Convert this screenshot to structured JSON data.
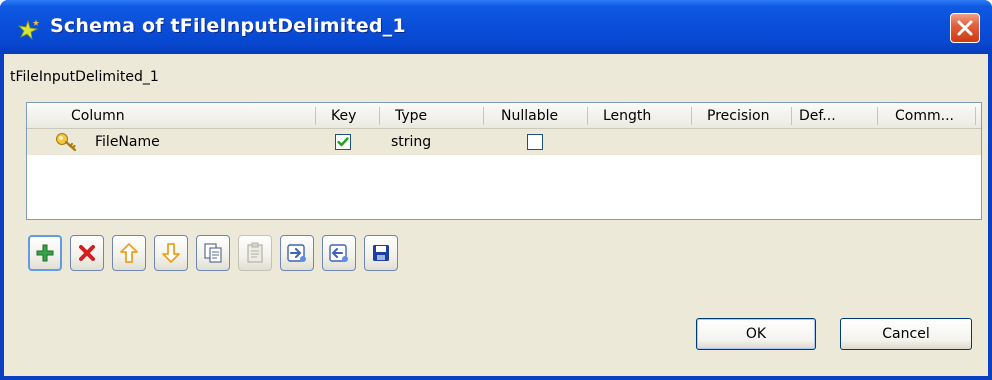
{
  "window": {
    "title": "Schema of tFileInputDelimited_1",
    "close_icon": "close-icon"
  },
  "component_label": "tFileInputDelimited_1",
  "table": {
    "columns": [
      "Column",
      "Key",
      "Type",
      "Nullable",
      "Length",
      "Precision",
      "Def...",
      "Comm..."
    ],
    "rows": [
      {
        "column": "FileName",
        "key": true,
        "type": "string",
        "nullable": false,
        "length": "",
        "precision": "",
        "default": "",
        "comment": ""
      }
    ]
  },
  "toolbar": {
    "buttons": [
      {
        "name": "add-icon",
        "enabled": true
      },
      {
        "name": "delete-icon",
        "enabled": true
      },
      {
        "name": "move-up-icon",
        "enabled": true
      },
      {
        "name": "move-down-icon",
        "enabled": true
      },
      {
        "name": "copy-icon",
        "enabled": true
      },
      {
        "name": "paste-icon",
        "enabled": false
      },
      {
        "name": "import-icon",
        "enabled": true
      },
      {
        "name": "export-icon",
        "enabled": true
      },
      {
        "name": "save-icon",
        "enabled": true
      }
    ]
  },
  "buttons": {
    "ok": "OK",
    "cancel": "Cancel"
  },
  "colors": {
    "titlebar": "#0a4fd9",
    "dialog_bg": "#ece9d8",
    "close_button": "#d8461a",
    "check_green": "#21a121",
    "add_green": "#3aa34a",
    "delete_red": "#d21f1f",
    "arrow_orange": "#f0a020",
    "save_blue": "#1d3fa0"
  }
}
